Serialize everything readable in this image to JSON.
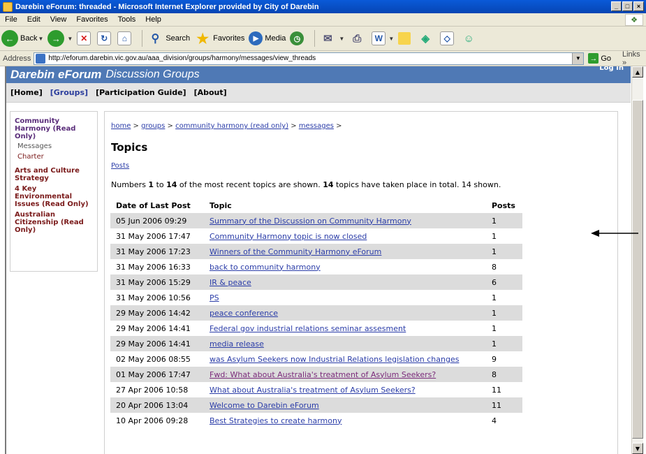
{
  "window": {
    "title": "Darebin eForum: threaded - Microsoft Internet Explorer provided by City of Darebin",
    "min": "_",
    "max": "□",
    "close": "×"
  },
  "menu": [
    "File",
    "Edit",
    "View",
    "Favorites",
    "Tools",
    "Help"
  ],
  "toolbar": {
    "back": "Back",
    "search": "Search",
    "favorites": "Favorites",
    "media": "Media"
  },
  "address": {
    "label": "Address",
    "url": "http://eforum.darebin.vic.gov.au/aaa_division/groups/harmony/messages/view_threads",
    "go": "Go",
    "links": "Links"
  },
  "site": {
    "brand": "Darebin eForum",
    "subtitle": "Discussion Groups",
    "login": "Log In",
    "nav": [
      "[Home]",
      "[Groups]",
      "[Participation Guide]",
      "[About]"
    ]
  },
  "sidebar": {
    "current_group": "Community Harmony (Read Only)",
    "items": [
      "Messages",
      "Charter"
    ],
    "groups": [
      "Arts and Culture Strategy",
      "4 Key Environmental Issues (Read Only)",
      "Australian Citizenship (Read Only)"
    ]
  },
  "content": {
    "breadcrumb": [
      "home",
      "groups",
      "community harmony (read only)",
      "messages"
    ],
    "title": "Topics",
    "posts_link": "Posts",
    "summary": {
      "prefix": "Numbers ",
      "from": "1",
      "to_word": " to ",
      "to": "14",
      "middle": " of the most recent topics are shown. ",
      "total": "14",
      "suffix": " topics have taken place in total. 14 shown."
    },
    "table": {
      "headers": [
        "Date of Last Post",
        "Topic",
        "Posts"
      ],
      "rows": [
        {
          "date": "05 Jun 2006 09:29",
          "topic": "Summary of the Discussion on Community Harmony",
          "posts": "1"
        },
        {
          "date": "31 May 2006 17:47",
          "topic": "Community Harmony topic is now closed",
          "posts": "1"
        },
        {
          "date": "31 May 2006 17:23",
          "topic": "Winners of the Community Harmony eForum",
          "posts": "1"
        },
        {
          "date": "31 May 2006 16:33",
          "topic": "back to community harmony",
          "posts": "8"
        },
        {
          "date": "31 May 2006 15:29",
          "topic": "IR & peace",
          "posts": "6"
        },
        {
          "date": "31 May 2006 10:56",
          "topic": "PS",
          "posts": "1"
        },
        {
          "date": "29 May 2006 14:42",
          "topic": "peace conference",
          "posts": "1"
        },
        {
          "date": "29 May 2006 14:41",
          "topic": "Federal gov industrial relations seminar assesment",
          "posts": "1"
        },
        {
          "date": "29 May 2006 14:41",
          "topic": "media release",
          "posts": "1"
        },
        {
          "date": "02 May 2006 08:55",
          "topic": "was Asylum Seekers now Industrial Relations legislation changes",
          "posts": "9"
        },
        {
          "date": "01 May 2006 17:47",
          "topic": "Fwd: What about Australia's treatment of Asylum Seekers?",
          "posts": "8"
        },
        {
          "date": "27 Apr 2006 10:58",
          "topic": "What about Australia's treatment of Asylum Seekers?",
          "posts": "11"
        },
        {
          "date": "20 Apr 2006 13:04",
          "topic": "Welcome to Darebin eForum",
          "posts": "11"
        },
        {
          "date": "10 Apr 2006 09:28",
          "topic": "Best Strategies to create harmony",
          "posts": "4"
        }
      ]
    }
  }
}
